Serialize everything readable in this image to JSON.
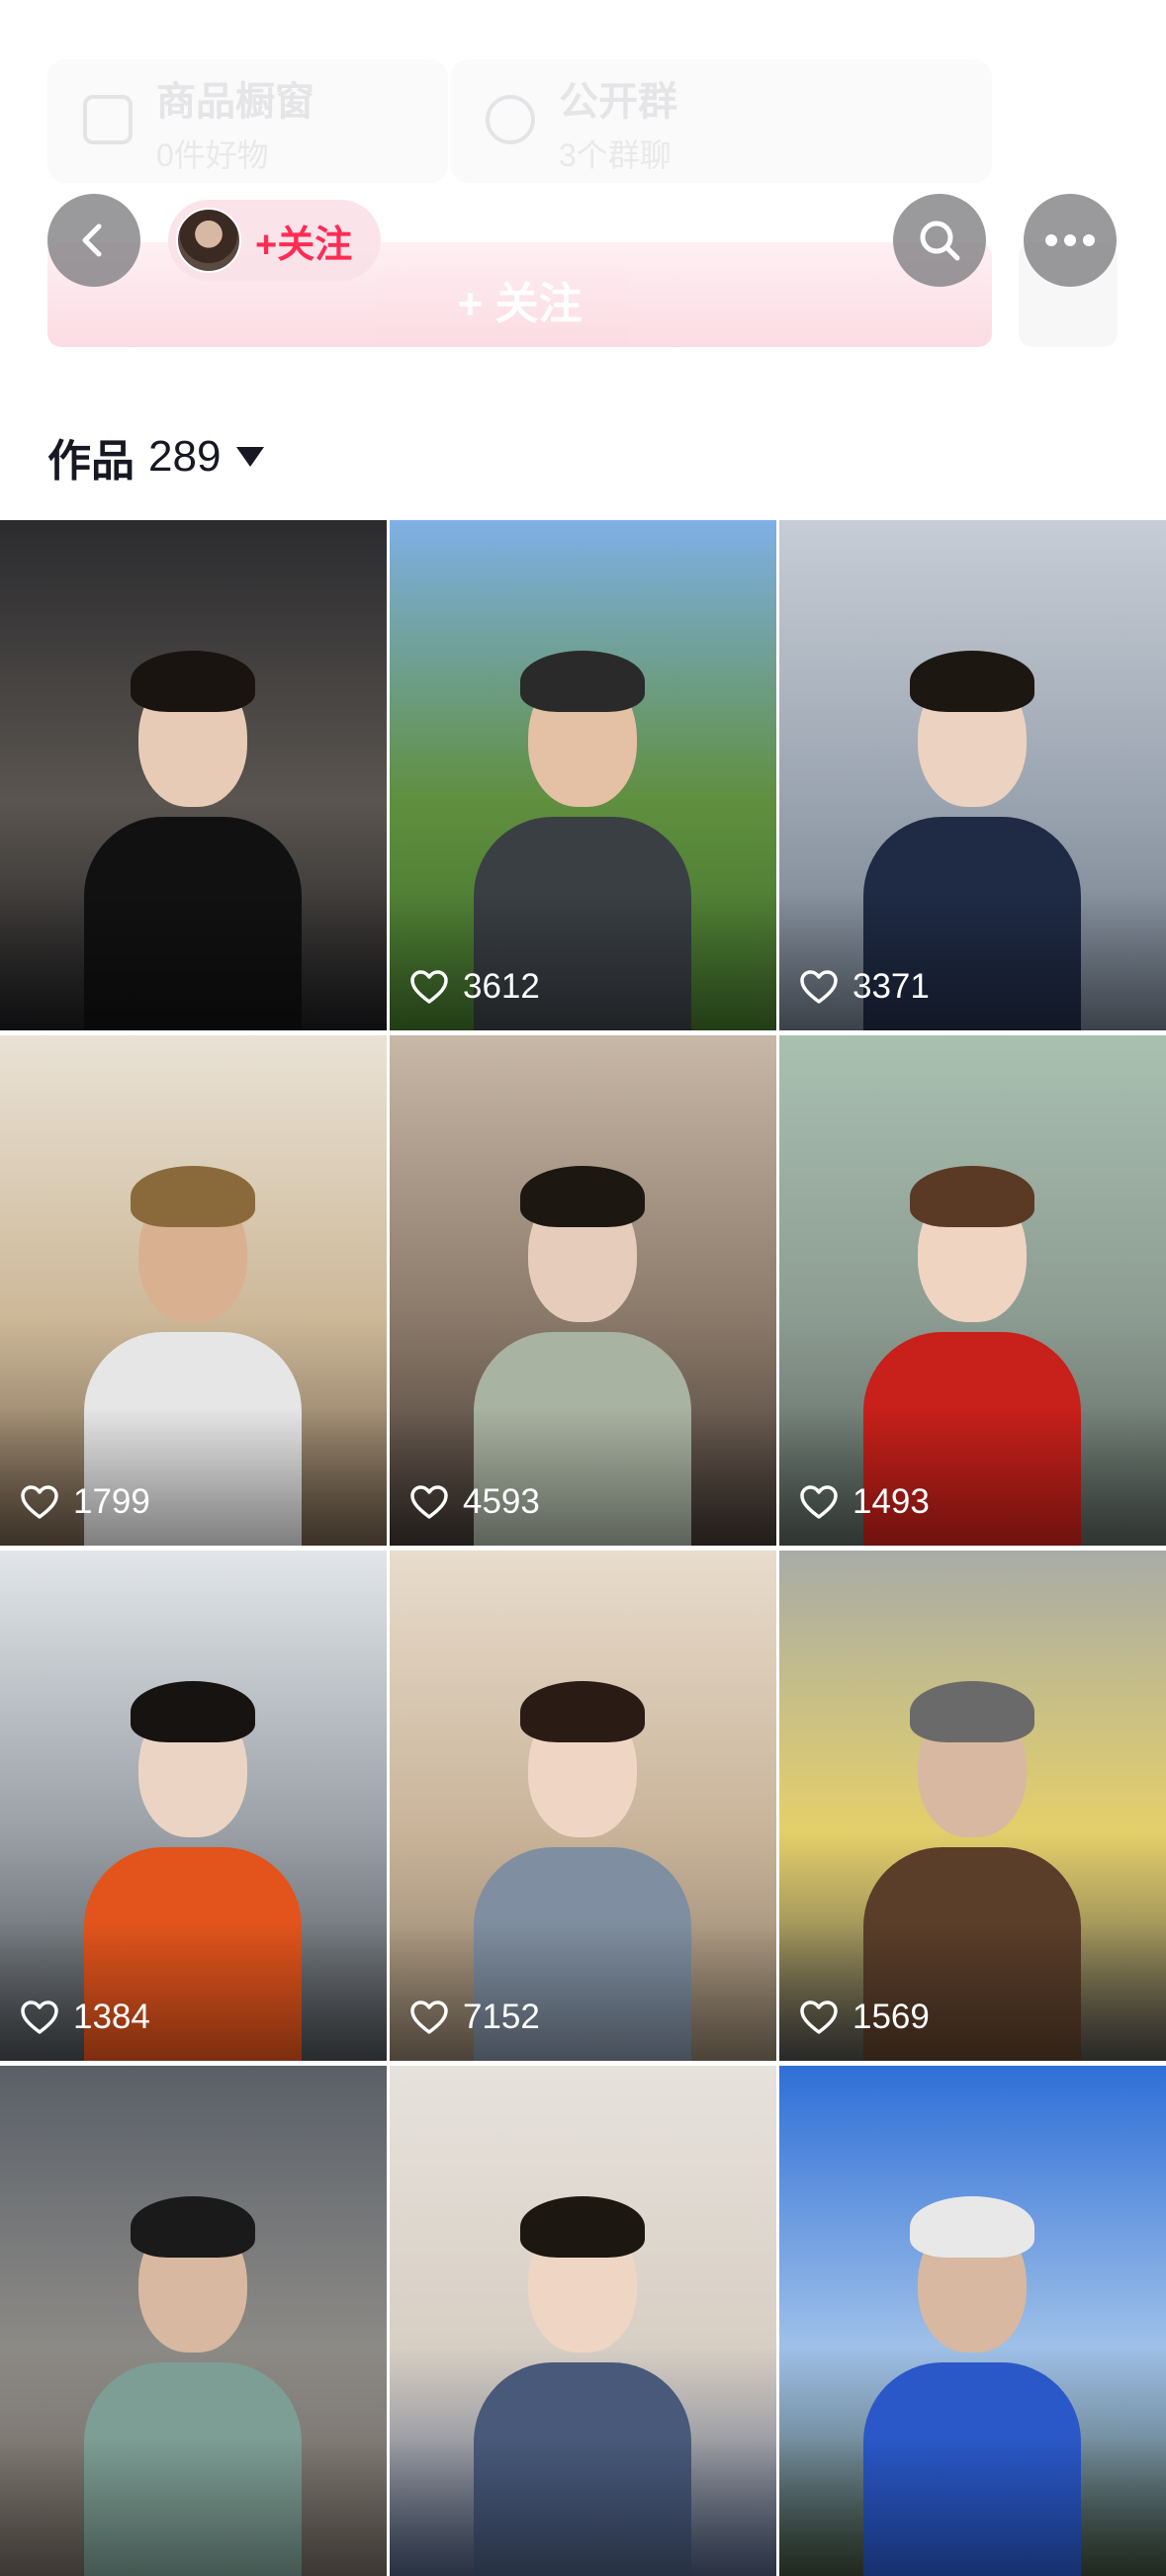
{
  "faded_profile": {
    "shop_card": {
      "title": "商品橱窗",
      "subtitle": "0件好物"
    },
    "group_card": {
      "title": "公开群",
      "subtitle": "3个群聊"
    },
    "follow_button": "+ 关注"
  },
  "header": {
    "follow_label": "+关注",
    "back_icon": "chevron-left-icon",
    "search_icon": "search-icon",
    "more_icon": "more-dots-icon"
  },
  "works": {
    "label": "作品",
    "count": "289"
  },
  "videos": [
    {
      "likes": "",
      "bg": [
        "#2b2b2e",
        "#5a5550",
        "#1c1c1e"
      ],
      "skin": "#e8cbb6",
      "hair": "#1a1410",
      "top": "#111111"
    },
    {
      "likes": "3612",
      "bg": [
        "#7fb0e6",
        "#5f8f3e",
        "#3f6e2a"
      ],
      "skin": "#e4c0a4",
      "hair": "#2a2a2a",
      "top": "#3a3f44"
    },
    {
      "likes": "3371",
      "bg": [
        "#c7cdd6",
        "#9aa4b0",
        "#6d7886"
      ],
      "skin": "#ecd2c0",
      "hair": "#1d1712",
      "top": "#1f2a44"
    },
    {
      "likes": "1799",
      "bg": [
        "#e9e2d6",
        "#cdb898",
        "#6b5a48"
      ],
      "skin": "#d9b190",
      "hair": "#8a6a3a",
      "top": "#e6e6e6"
    },
    {
      "likes": "4593",
      "bg": [
        "#c8b8a8",
        "#8b7a6a",
        "#3e3530"
      ],
      "skin": "#e6cdbb",
      "hair": "#1d1712",
      "top": "#a9b3a2"
    },
    {
      "likes": "1493",
      "bg": [
        "#a9c0b0",
        "#8d9c92",
        "#55605a"
      ],
      "skin": "#efd4c2",
      "hair": "#5a3a24",
      "top": "#c8201a"
    },
    {
      "likes": "1384",
      "bg": [
        "#e2e6ea",
        "#9aa0a6",
        "#4a4e52"
      ],
      "skin": "#ecd4c4",
      "hair": "#171310",
      "top": "#e2541c"
    },
    {
      "likes": "7152",
      "bg": [
        "#e8dccc",
        "#c9b49a",
        "#8a7a66"
      ],
      "skin": "#efd6c4",
      "hair": "#2a1c14",
      "top": "#7f8ea0"
    },
    {
      "likes": "1569",
      "bg": [
        "#a8aca6",
        "#e4d06a",
        "#4a4a48"
      ],
      "skin": "#d8b8a0",
      "hair": "#6a6a6a",
      "top": "#5a3e2a"
    },
    {
      "likes": "",
      "bg": [
        "#5a6068",
        "#8c8a86",
        "#6e655c"
      ],
      "skin": "#d8b8a0",
      "hair": "#1a1a1a",
      "top": "#7d9e94"
    },
    {
      "likes": "",
      "bg": [
        "#e6e2dc",
        "#d8cfc4",
        "#4a5a78"
      ],
      "skin": "#efd6c4",
      "hair": "#1d1712",
      "top": "#48597a"
    },
    {
      "likes": "",
      "bg": [
        "#2f6fd6",
        "#9fc0e8",
        "#3a4a38"
      ],
      "skin": "#d8b8a0",
      "hair": "#e8e8e8",
      "top": "#2a58c8"
    }
  ],
  "colors": {
    "accent": "#fe2c55",
    "text": "#161823",
    "overlay_button": "#78787c"
  }
}
